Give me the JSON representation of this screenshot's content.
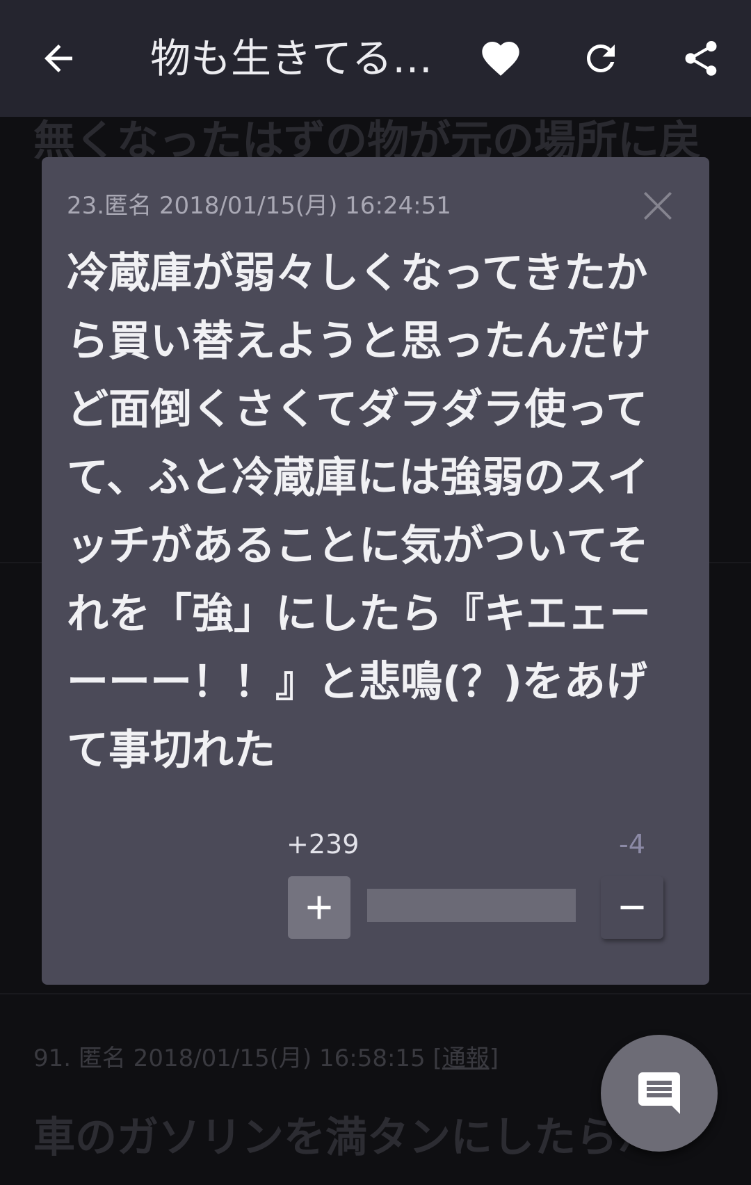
{
  "appbar": {
    "title": "物も生きてる…",
    "icons": [
      "back-arrow-icon",
      "heart-icon",
      "refresh-icon",
      "share-icon"
    ]
  },
  "background": {
    "heading_fragment": "無くなったはずの物が元の場所に戻",
    "post_meta_prefix": "91. 匿名 2018/01/15(月) 16:58:15 ",
    "post_meta_report": "[通報]",
    "post_body_fragment": "車のガソリンを満タンにしたらハ"
  },
  "popup": {
    "meta": "23.匿名 2018/01/15(月) 16:24:51",
    "body": "冷蔵庫が弱々しくなってきたから買い替えようと思ったんだけど面倒くさくてダラダラ使ってて、ふと冷蔵庫には強弱のスイッチがあることに気がついてそれを「強」にしたら『キエェーーーー！！』と悲鳴(？)をあげて事切れた",
    "plus_count": "+239",
    "minus_count": "-4",
    "vote_ratio": 0.98
  },
  "colors": {
    "appbar": "#25252f",
    "popup": "#4b4a58",
    "text": "#f1f1f4",
    "minus_accent": "#8c8aa6"
  }
}
